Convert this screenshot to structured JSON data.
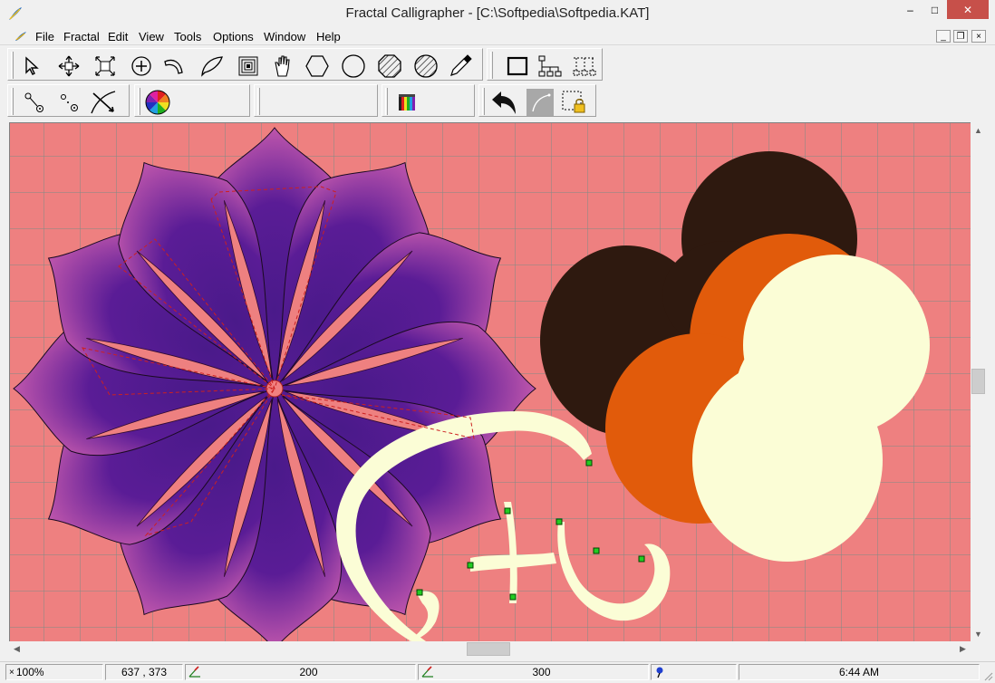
{
  "window": {
    "title": "Fractal Calligrapher - [C:\\Softpedia\\Softpedia.KAT]",
    "icon": "app-feather-icon",
    "controls": {
      "minimize": "–",
      "maximize": "□",
      "close": "✕"
    }
  },
  "menubar": {
    "items": [
      "File",
      "Fractal",
      "Edit",
      "View",
      "Tools",
      "Options",
      "Window",
      "Help"
    ],
    "mdi_controls": {
      "minimize": "_",
      "restore": "❐",
      "close": "×"
    }
  },
  "toolbar1": {
    "tools": [
      "select-arrow-icon",
      "move-icon",
      "scale-icon",
      "add-point-icon",
      "curve-icon",
      "leaf-icon",
      "frame-icon",
      "hand-icon",
      "hexagon-icon",
      "circle-icon",
      "hatched-octagon-icon",
      "hatched-circle-icon",
      "pipette-icon"
    ],
    "group2": [
      "rectangle-icon",
      "tree-icon",
      "dotted-tree-icon"
    ]
  },
  "toolbar2": {
    "tools": [
      "node-icon",
      "node-alt-icon",
      "bezier-icon"
    ],
    "palette": "color-wheel-icon",
    "color_bars": "color-bars-icon",
    "group_end": [
      "undo-arrow-icon",
      "curve-gray-icon",
      "lock-selection-icon"
    ]
  },
  "status": {
    "zoom": "100%",
    "coords": "637 , 373",
    "value1": "200",
    "value2": "300",
    "time": "6:44 AM"
  },
  "colors": {
    "canvas_bg": "#ee8080",
    "grid": "#7e8c86",
    "petal_dark": "#4a1a8a",
    "petal_glow": "#c050b0",
    "brown": "#2e190f",
    "orange": "#e15b0b",
    "cream": "#fbfdd6",
    "handle": "#22cc22"
  }
}
